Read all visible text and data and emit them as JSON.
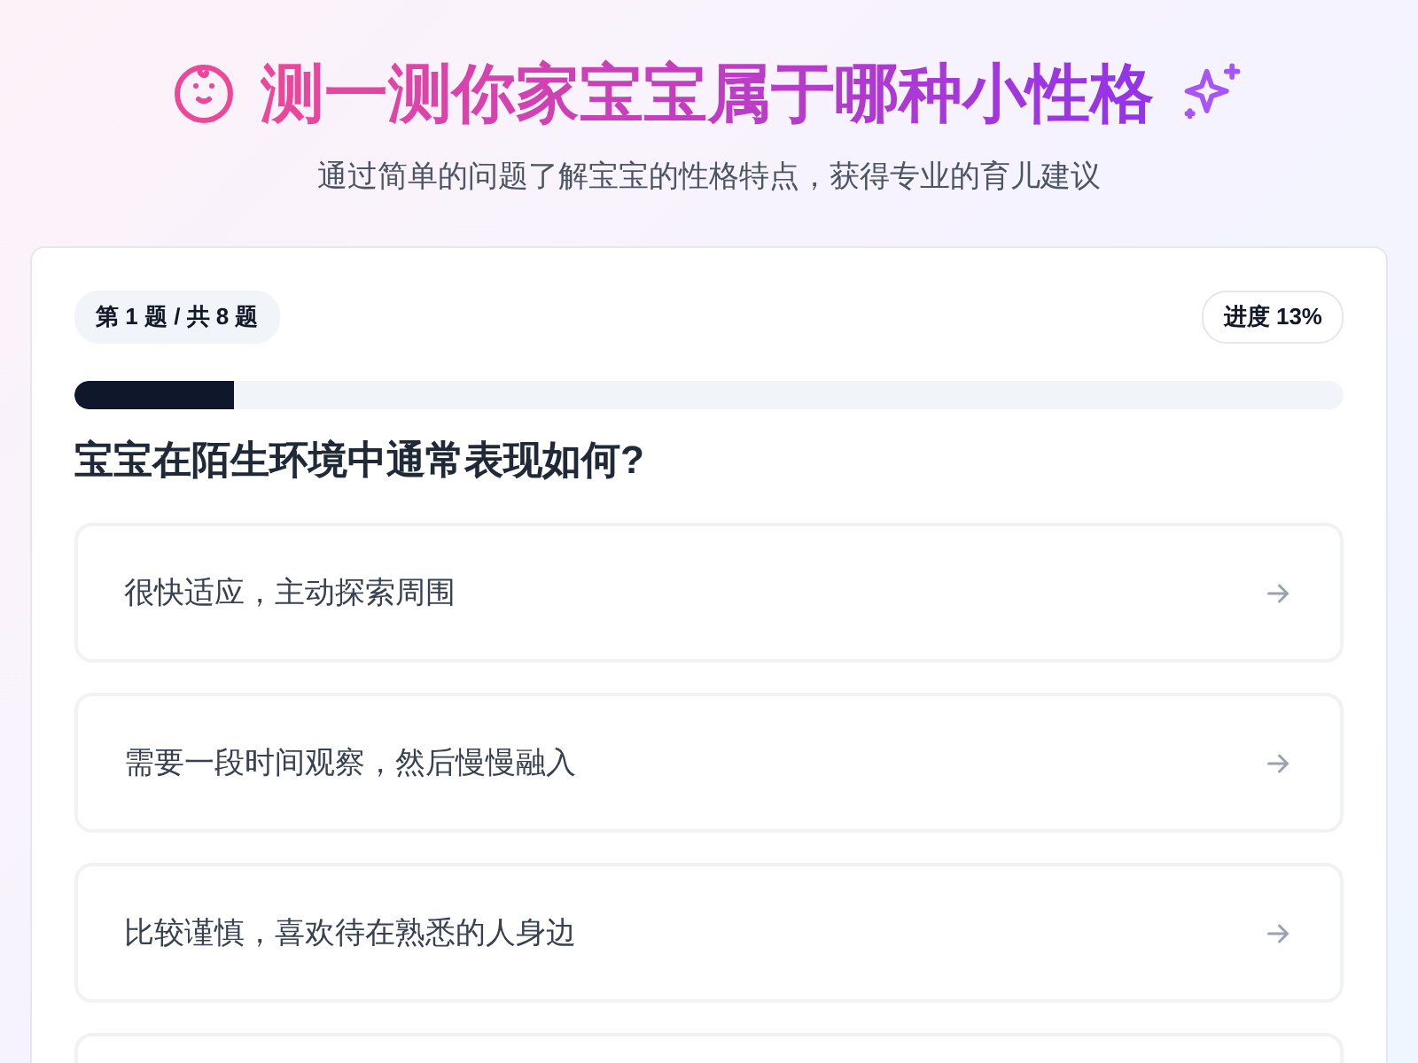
{
  "header": {
    "title": "测一测你家宝宝属于哪种小性格",
    "subtitle": "通过简单的问题了解宝宝的性格特点，获得专业的育儿建议"
  },
  "quiz": {
    "counter": "第 1 题 / 共 8 题",
    "progress_label": "进度 13%",
    "level": 0.125,
    "question": "宝宝在陌生环境中通常表现如何?",
    "options": [
      {
        "kind": "answer",
        "label": "很快适应，主动探索周围"
      },
      {
        "kind": "answer",
        "label": "需要一段时间观察，然后慢慢融入"
      },
      {
        "kind": "answer",
        "label": "比较谨慎，喜欢待在熟悉的人身边"
      },
      {
        "kind": "cut_off"
      }
    ]
  }
}
